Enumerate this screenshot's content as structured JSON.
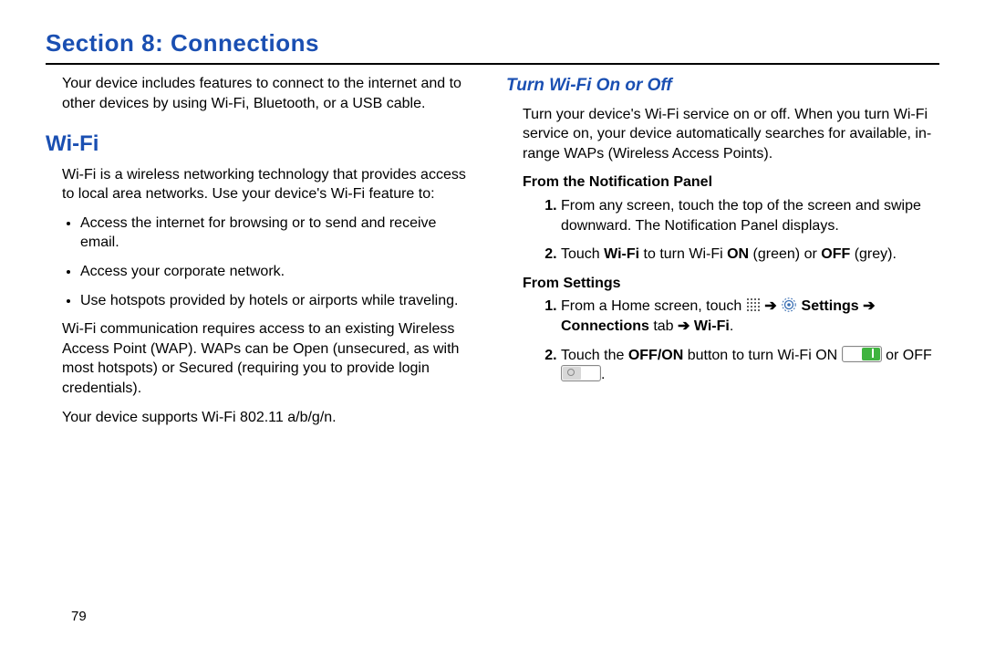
{
  "section_title": "Section 8: Connections",
  "page_number": "79",
  "left": {
    "intro": "Your device includes features to connect to the internet and to other devices by using Wi-Fi, Bluetooth, or a USB cable.",
    "wifi_heading": "Wi-Fi",
    "wifi_intro": "Wi-Fi is a wireless networking technology that provides access to local area networks. Use your device's Wi-Fi feature to:",
    "bullets": [
      "Access the internet for browsing or to send and receive email.",
      "Access your corporate network.",
      "Use hotspots provided by hotels or airports while traveling."
    ],
    "wap_para": "Wi-Fi communication requires access to an existing Wireless Access Point (WAP). WAPs can be Open (unsecured, as with most hotspots) or Secured (requiring you to provide login credentials).",
    "support_para": "Your device supports Wi-Fi 802.11 a/b/g/n."
  },
  "right": {
    "sub_heading": "Turn Wi-Fi On or Off",
    "intro": "Turn your device's Wi-Fi service on or off. When you turn Wi-Fi service on, your device automatically searches for available, in-range WAPs (Wireless Access Points).",
    "from_notif_label": "From the Notification Panel",
    "notif_steps": {
      "s1": "From any screen, touch the top of the screen and swipe downward. The Notification Panel displays.",
      "s2_pre": "Touch ",
      "s2_wifi": "Wi-Fi",
      "s2_mid": " to turn Wi-Fi ",
      "s2_on": "ON",
      "s2_green": " (green) or ",
      "s2_off": "OFF",
      "s2_grey": " (grey)."
    },
    "from_settings_label": "From Settings",
    "settings_steps": {
      "s1_pre": "From a Home screen, touch ",
      "s1_arrow1": " ➔ ",
      "s1_settings": " Settings",
      "s1_arrow2": " ➔ ",
      "s1_connections": "Connections",
      "s1_tab": " tab ",
      "s1_arrow3": "➔ ",
      "s1_wifi": "Wi-Fi",
      "s1_end": ".",
      "s2_pre": "Touch the ",
      "s2_offon": "OFF/ON",
      "s2_mid1": " button to turn Wi-Fi ON ",
      "s2_mid2": " or OFF ",
      "s2_end": "."
    }
  }
}
